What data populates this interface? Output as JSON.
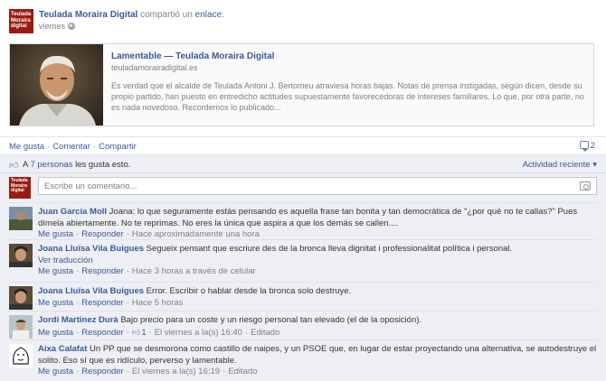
{
  "post": {
    "page_name": "Teulada Moraira Digital",
    "action_prefix": " compartió un ",
    "action_link": "enlace",
    "action_suffix": ".",
    "time": "viernes",
    "avatar_lines": [
      "Teulada",
      "Moraira",
      "digital"
    ]
  },
  "link_share": {
    "title": "Lamentable — Teulada Moraira Digital",
    "domain": "teuladamorairadigital.es",
    "description": "Es verdad que el alcalde de Teulada Antoni J. Bertomeu atraviesa horas bajas. Notas de prensa instigadas, según dicen, desde su propio partido, han puesto en entredicho actitudes supuestamente favorecedoras de intereses familiares. Lo que, por otra parte, no es nada novedoso. Recordemos lo publicado..."
  },
  "actions": {
    "like": "Me gusta",
    "comment": "Comentar",
    "share": "Compartir",
    "comment_count": "2"
  },
  "likes": {
    "prefix": "A ",
    "people": "7 personas",
    "suffix": " les gusta esto.",
    "recent_activity": "Actividad reciente ▾"
  },
  "composer": {
    "placeholder": "Escribe un comentario..."
  },
  "comments": [
    {
      "author": "Juan Garcia Moll",
      "text": " Joana: lo que seguramente estás pensando es aquella frase tan bonita y tan democrática de \"¿por qué no te callas?\" Pues dímela abiertamente. No te reprimas. No eres la única que aspira a que los demás se callen....",
      "like": "Me gusta",
      "reply": "Responder",
      "meta": "Hace aproximadamente una hora"
    },
    {
      "author": "Joana Lluïsa Vila Buigues",
      "text": " Segueix pensant que escriure des de la bronca lleva dignitat i professionalitat política i personal.",
      "translate": "Ver traducción",
      "like": "Me gusta",
      "reply": "Responder",
      "meta": "Hace 3 horas a través de celular"
    },
    {
      "author": "Joana Lluïsa Vila Buigues",
      "text": " Error. Escribir o hablar desde la bronca solo destruye.",
      "like": "Me gusta",
      "reply": "Responder",
      "meta": "Hace 5 horas"
    },
    {
      "author": "Jordi Martinez Durà",
      "text": " Bajo precio para un coste y un riesgo personal tan elevado (el de la oposición).",
      "like": "Me gusta",
      "reply": "Responder",
      "like_count": "1",
      "meta": "El viernes a la(s) 16:40",
      "edited": "Editado"
    },
    {
      "author": "Aixa Calafat",
      "text": " Un PP que se desmorona como castillo de naipes, y un PSOE que, en lugar de estar proyectando una alternativa, se autodestruye el solito. Eso sí que es ridículo, perverso y lamentable.",
      "like": "Me gusta",
      "reply": "Responder",
      "meta": "El viernes a la(s) 16:19",
      "edited": "Editado"
    }
  ],
  "colors": {
    "link": "#3b5998",
    "feedback_bg": "#edeff4",
    "page_brand": "#9b1b12"
  }
}
